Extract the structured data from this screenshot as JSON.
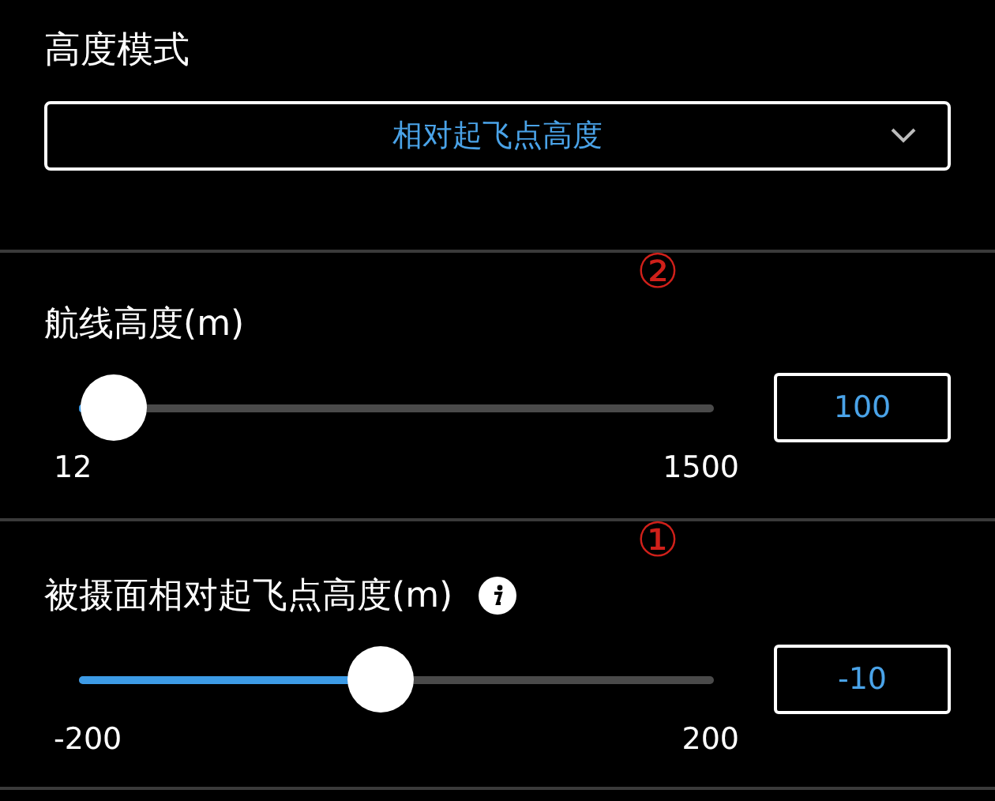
{
  "height_mode": {
    "label": "高度模式",
    "dropdown": {
      "value": "相对起飞点高度"
    }
  },
  "sections": [
    {
      "annotation": "②",
      "label": "航线高度(m)",
      "info": false,
      "slider": {
        "level": 0.055,
        "min": "12",
        "max": "1500"
      },
      "value": "100"
    },
    {
      "annotation": "①",
      "label": "被摄面相对起飞点高度(m)",
      "info": true,
      "slider": {
        "level": 0.475,
        "min": "-200",
        "max": "200"
      },
      "value": "-10"
    }
  ]
}
